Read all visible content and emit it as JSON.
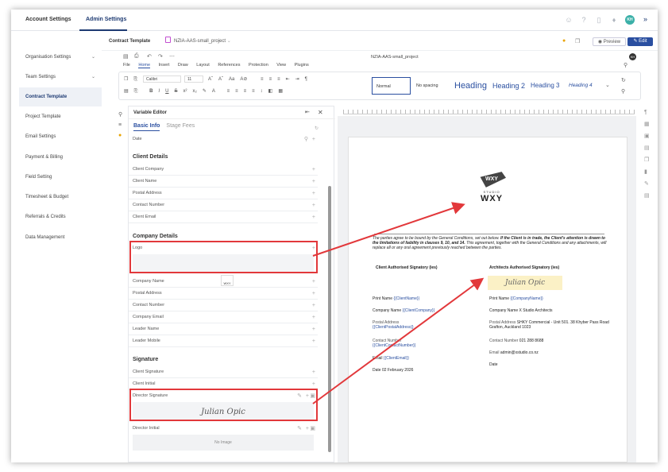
{
  "topbar": {
    "tabs": [
      "Account Settings",
      "Admin Settings"
    ],
    "avatar": "KH"
  },
  "sidebar": {
    "items": [
      "Organisation Settings",
      "Team Settings",
      "Contract Template",
      "Project Template",
      "Email Settings",
      "Payment & Billing",
      "Field Setting",
      "Timesheet & Budget",
      "Referrals & Credits",
      "Data Management"
    ]
  },
  "header": {
    "title": "Contract Template",
    "file_name": "NZIA-AAS-small_project",
    "preview": "Preview",
    "edit": "Edit"
  },
  "editor": {
    "doc_name": "NZIA-AAS-small_project",
    "menus": [
      "File",
      "Home",
      "Insert",
      "Draw",
      "Layout",
      "References",
      "Protection",
      "View",
      "Plugins"
    ],
    "font": "Calibri",
    "size": "11",
    "styles": [
      "Normal",
      "No spacing",
      "Heading 1",
      "Heading 2",
      "Heading 3",
      "Heading 4"
    ]
  },
  "variables": {
    "title": "Variable Editor",
    "tabs": [
      "Basic Info",
      "Stage Fees"
    ],
    "date": "Date",
    "client_heading": "Client Details",
    "client": [
      "Client Company",
      "Client Name",
      "Postal Address",
      "Contact Number",
      "Client Email"
    ],
    "company_heading": "Company Details",
    "logo": "Logo",
    "logo_thumb": "WXY",
    "company": [
      "Company Name",
      "Postal Address",
      "Contact Number",
      "Company Email",
      "Leader Name",
      "Leader Mobile"
    ],
    "signature_heading": "Signature",
    "signature": [
      "Client Signature",
      "Client Initial"
    ],
    "director_signature": "Director Signature",
    "director_signature_value": "Julian Opic",
    "director_initial": "Director Initial",
    "no_image": "No Image"
  },
  "document": {
    "logo_sub": "STUDIO",
    "logo_word": "WXY",
    "intro_1": "The parties agree to be bound by the General Conditions, set out below.",
    "intro_bold": "If the Client is in trade, the Client's attention is drawn to the limitations of liability in clauses 9, 10, and 14.",
    "intro_2": "This agreement, together with the General Conditions and any attachments, will replace all or any oral agreement previously reached between the parties.",
    "client_col_title": "Client Authorised Signatory (ies)",
    "architect_col_title": "Architects Authorised Signatory (ies)",
    "signature_stamp": "Julian Opic",
    "left": {
      "print_name": "Print Name",
      "print_name_tag": "{{ClientName}}",
      "company_name": "Company Name",
      "company_name_tag": "{{ClientCompany}}",
      "postal_address": "Postal Address",
      "postal_address_tag": "{{ClientPostalAddress}}",
      "contact_number": "Contact Number",
      "contact_number_tag": "{{ClientContactNumber}}",
      "email": "Email",
      "email_tag": "{{ClientEmail}}",
      "date": "Date",
      "date_value": "02 February 2026"
    },
    "right": {
      "print_name": "Print Name",
      "print_name_tag": "{{CompanyName}}",
      "company_name": "Company Name",
      "company_name_value": "X Studio Architects",
      "postal_address": "Postal Address",
      "postal_address_value": "SHKY Commercial - Unit 501. 38 Khyber Pass Road Grafton, Auckland 1023",
      "contact_number": "Contact Number",
      "contact_number_value": "021 288 8688",
      "email": "Email",
      "email_value": "admin@xstudio.co.nz",
      "date": "Date"
    }
  },
  "colors": {
    "accent": "#2a4fa0",
    "highlight": "#e2383b"
  }
}
